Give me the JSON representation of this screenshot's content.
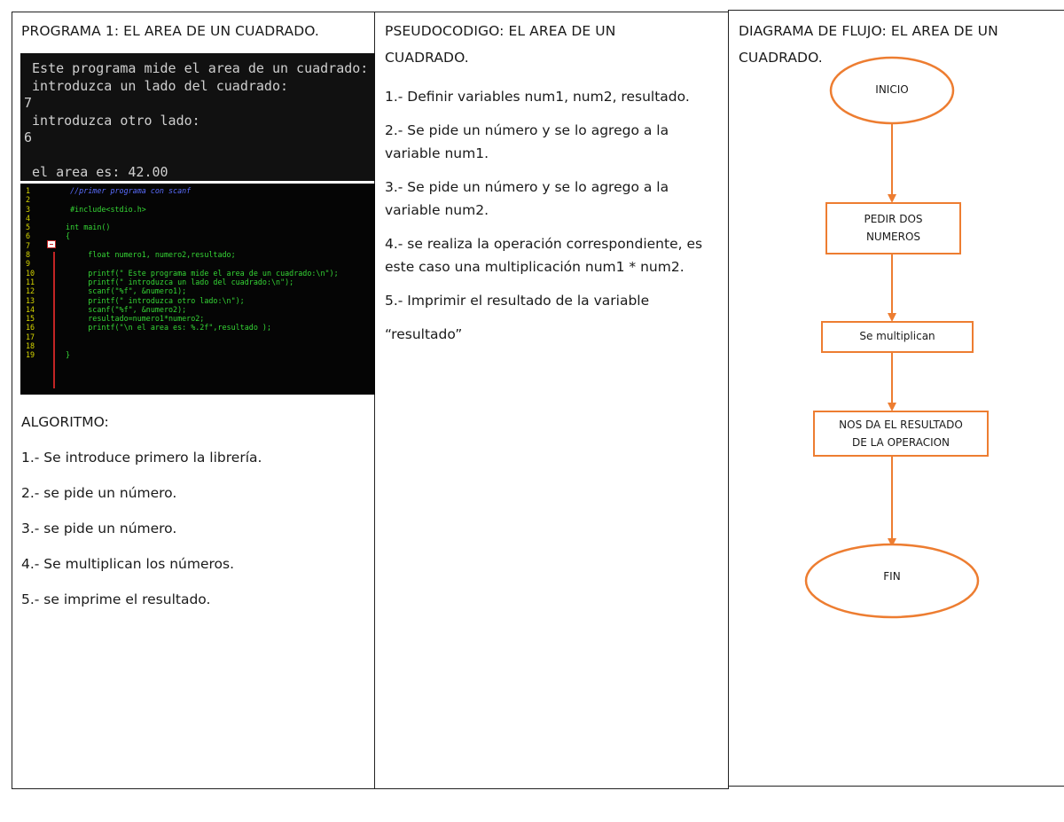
{
  "col1": {
    "title": "PROGRAMA 1: EL AREA DE UN CUADRADO.",
    "console_lines": [
      " Este programa mide el area de un cuadrado:",
      " introduzca un lado del cuadrado:",
      "7",
      " introduzca otro lado:",
      "6",
      "",
      " el area es: 42.00"
    ],
    "code_lines": [
      {
        "n": "1",
        "text": "  //primer programa con scanf",
        "kind": "comment"
      },
      {
        "n": "2",
        "text": "",
        "kind": "code"
      },
      {
        "n": "3",
        "text": "  #include<stdio.h>",
        "kind": "code"
      },
      {
        "n": "4",
        "text": "",
        "kind": "code"
      },
      {
        "n": "5",
        "text": " int main()",
        "kind": "code"
      },
      {
        "n": "6",
        "text": " {",
        "kind": "code"
      },
      {
        "n": "7",
        "text": "",
        "kind": "code"
      },
      {
        "n": "8",
        "text": "      float numero1, numero2,resultado;",
        "kind": "code"
      },
      {
        "n": "9",
        "text": "",
        "kind": "code"
      },
      {
        "n": "10",
        "text": "      printf(\" Este programa mide el area de un cuadrado:\\n\");",
        "kind": "code"
      },
      {
        "n": "11",
        "text": "      printf(\" introduzca un lado del cuadrado:\\n\");",
        "kind": "code"
      },
      {
        "n": "12",
        "text": "      scanf(\"%f\", &numero1);",
        "kind": "code"
      },
      {
        "n": "13",
        "text": "      printf(\" introduzca otro lado:\\n\");",
        "kind": "code"
      },
      {
        "n": "14",
        "text": "      scanf(\"%f\", &numero2);",
        "kind": "code"
      },
      {
        "n": "15",
        "text": "      resultado=numero1*numero2;",
        "kind": "code"
      },
      {
        "n": "16",
        "text": "      printf(\"\\n el area es: %.2f\",resultado );",
        "kind": "code"
      },
      {
        "n": "17",
        "text": "",
        "kind": "code"
      },
      {
        "n": "18",
        "text": "",
        "kind": "code"
      },
      {
        "n": "19",
        "text": " }",
        "kind": "code"
      }
    ],
    "algorithm_title": "ALGORITMO:",
    "algorithm_steps": [
      "1.- Se introduce primero la librería.",
      "2.- se pide un número.",
      "3.- se pide un número.",
      "4.- Se multiplican los números.",
      "5.- se imprime el resultado."
    ]
  },
  "col2": {
    "title_line1": "PSEUDOCODIGO: EL AREA DE UN",
    "title_line2": "CUADRADO.",
    "steps": [
      "1.- Definir variables num1, num2, resultado.",
      "2.- Se pide un número y se lo agrego a la variable num1.",
      "3.- Se pide un número y se lo agrego a la variable num2.",
      "4.- se realiza la operación correspondiente, es este caso una multiplicación num1 * num2.",
      "5.- Imprimir el resultado de la variable",
      "“resultado”"
    ]
  },
  "col3": {
    "title_line1": "DIAGRAMA DE FLUJO: EL AREA DE UN",
    "title_line2": "CUADRADO.",
    "flow": {
      "start": "INICIO",
      "step1_line1": "PEDIR DOS",
      "step1_line2": "NUMEROS",
      "step2": "Se multiplican",
      "step3_line1": "NOS DA EL RESULTADO",
      "step3_line2": "DE LA OPERACION",
      "end": "FIN",
      "shape_color": "#ed7d31"
    }
  }
}
